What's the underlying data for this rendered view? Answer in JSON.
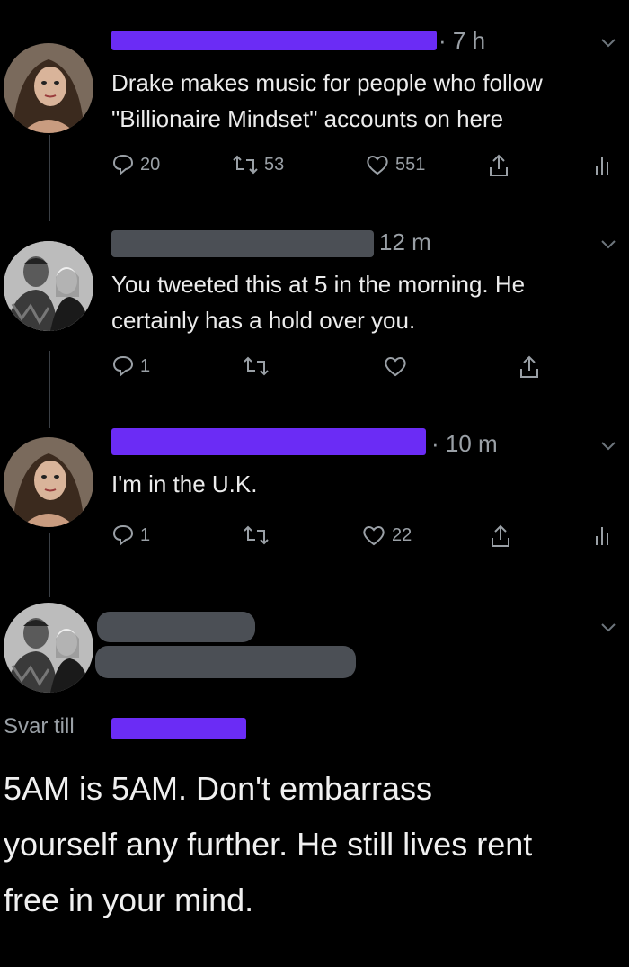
{
  "tweets": [
    {
      "time": "· 7 h",
      "text_lines": [
        "Drake makes music for people who follow",
        "\"Billionaire Mindset\" accounts on here"
      ],
      "replies": "20",
      "retweets": "53",
      "likes": "551"
    },
    {
      "time": "12 m",
      "text_lines": [
        "You tweeted this at 5 in the morning. He",
        "certainly has a hold over you."
      ],
      "replies": "1",
      "retweets": "",
      "likes": ""
    },
    {
      "time": "· 10 m",
      "text_lines": [
        "I'm in the U.K."
      ],
      "replies": "1",
      "retweets": "",
      "likes": "22"
    }
  ],
  "main_reply": {
    "reply_to_label": "Svar till",
    "text_lines": [
      "5AM is 5AM. Don't embarrass",
      "yourself any further. He still lives rent",
      "free in your mind."
    ]
  },
  "colors": {
    "redaction_purple": "#6b2cf5",
    "redaction_gray": "#4b4f55",
    "muted": "#9aa0a6"
  },
  "icons": [
    "reply-icon",
    "retweet-icon",
    "like-icon",
    "share-icon",
    "analytics-icon",
    "chevron-down-icon"
  ]
}
